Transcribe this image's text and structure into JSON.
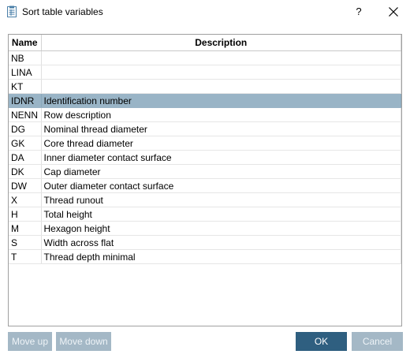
{
  "window": {
    "title": "Sort table variables",
    "help_label": "?"
  },
  "table": {
    "columns": [
      "Name",
      "Description"
    ],
    "selected_index": 3,
    "rows": [
      {
        "name": "NB",
        "description": ""
      },
      {
        "name": "LINA",
        "description": ""
      },
      {
        "name": "KT",
        "description": ""
      },
      {
        "name": "IDNR",
        "description": "Identification number"
      },
      {
        "name": "NENN",
        "description": "Row description"
      },
      {
        "name": "DG",
        "description": "Nominal thread diameter"
      },
      {
        "name": "GK",
        "description": "Core thread diameter"
      },
      {
        "name": "DA",
        "description": "Inner diameter contact surface"
      },
      {
        "name": "DK",
        "description": "Cap diameter"
      },
      {
        "name": "DW",
        "description": "Outer diameter contact surface"
      },
      {
        "name": "X",
        "description": "Thread runout"
      },
      {
        "name": "H",
        "description": "Total height"
      },
      {
        "name": "M",
        "description": "Hexagon height"
      },
      {
        "name": "S",
        "description": "Width across flat"
      },
      {
        "name": "T",
        "description": "Thread depth minimal"
      }
    ]
  },
  "buttons": {
    "move_up": "Move up",
    "move_down": "Move down",
    "ok": "OK",
    "cancel": "Cancel"
  },
  "colors": {
    "selected_row": "#99b4c6",
    "primary_button": "#2f5f80",
    "disabled_button": "#a4b8c6"
  }
}
